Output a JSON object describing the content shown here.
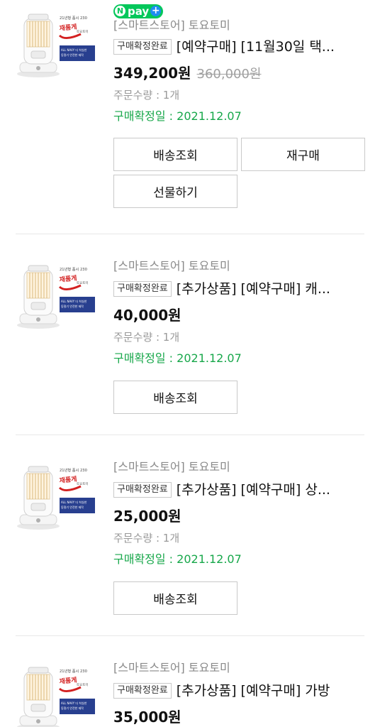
{
  "orders": [
    {
      "npay": {
        "n": "N",
        "text": "pay",
        "plus": "+"
      },
      "product_image": "kerosene-heater-product-image",
      "image_text": {
        "top": "21년형 품시 230",
        "red": "재품게",
        "side": "토요토미",
        "box": "ALL NAVY 더 착실한 동절기"
      },
      "store": "[스마트스토어] 토요토미",
      "badge": "구매확정완료",
      "title": "[예약구매] [11월30일 택...",
      "price": "349,200원",
      "old_price": "360,000원",
      "quantity": "주문수량 : 1개",
      "confirm_date": "구매확정일 : 2021.12.07",
      "buttons": [
        "배송조회",
        "재구매",
        "선물하기"
      ]
    },
    {
      "product_image": "kerosene-heater-product-image",
      "image_text": {
        "top": "21년형 품시 230",
        "red": "재품게",
        "side": "토요토미",
        "box": "ALL NAVY 더 착실한 동절기"
      },
      "store": "[스마트스토어] 토요토미",
      "badge": "구매확정완료",
      "title": "[추가상품] [예약구매] 캐...",
      "price": "40,000원",
      "quantity": "주문수량 : 1개",
      "confirm_date": "구매확정일 : 2021.12.07",
      "buttons": [
        "배송조회"
      ]
    },
    {
      "product_image": "kerosene-heater-product-image",
      "image_text": {
        "top": "21년형 품시 230",
        "red": "재품게",
        "side": "토요토미",
        "box": "ALL NAVY 더 착실한 동절기"
      },
      "store": "[스마트스토어] 토요토미",
      "badge": "구매확정완료",
      "title": "[추가상품] [예약구매] 상...",
      "price": "25,000원",
      "quantity": "주문수량 : 1개",
      "confirm_date": "구매확정일 : 2021.12.07",
      "buttons": [
        "배송조회"
      ]
    },
    {
      "product_image": "kerosene-heater-product-image",
      "image_text": {
        "top": "21년형 품시 230",
        "red": "재품게",
        "side": "토요토미",
        "box": "ALL NAVY 더 착실한 동절기"
      },
      "store": "[스마트스토어] 토요토미",
      "badge": "구매확정완료",
      "title": "[추가상품] [예약구매] 가방",
      "price": "35,000원"
    }
  ],
  "colors": {
    "green": "#17a74a",
    "npay_green": "#03c75a",
    "npay_blue": "#1e8df0",
    "strike_gray": "#a0a0a0"
  }
}
